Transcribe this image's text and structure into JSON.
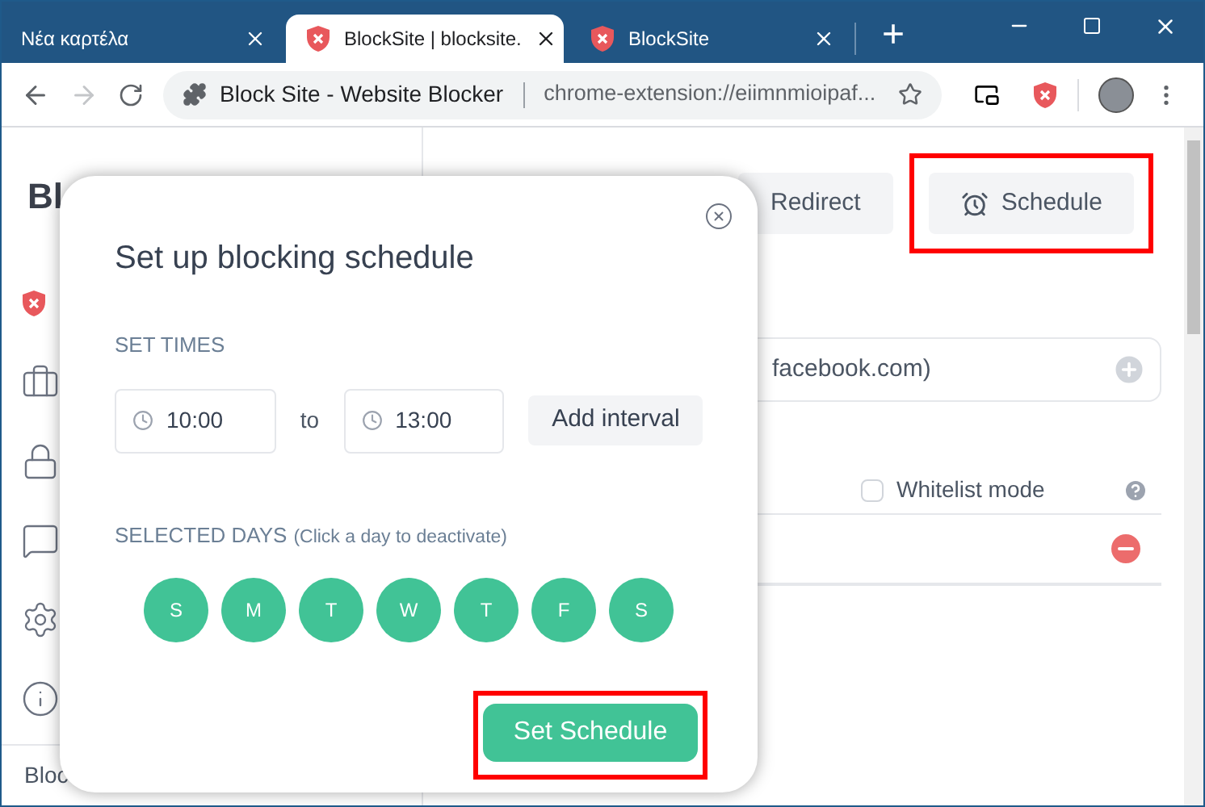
{
  "browser": {
    "tabs": [
      {
        "title": "Νέα καρτέλα",
        "selected": false,
        "favicon": false
      },
      {
        "title": "BlockSite | blocksite.",
        "selected": true,
        "favicon": true
      },
      {
        "title": "BlockSite",
        "selected": false,
        "favicon": true
      }
    ],
    "new_tab": "+",
    "address_bar": {
      "site_name": "Block Site - Website Blocker",
      "url": "chrome-extension://eiimnmioipaf..."
    }
  },
  "sidebar": {
    "title": "Bl",
    "footer": "Bloc",
    "items": [
      {
        "kind": "shield",
        "active": true
      },
      {
        "kind": "briefcase",
        "active": false
      },
      {
        "kind": "lock",
        "active": false
      },
      {
        "kind": "chat",
        "active": false
      },
      {
        "kind": "gear",
        "active": false
      },
      {
        "kind": "info",
        "active": false
      }
    ]
  },
  "main": {
    "tabs": [
      {
        "label": "Redirect",
        "highlighted": false
      },
      {
        "label": "Schedule",
        "highlighted": true
      }
    ],
    "site_input": {
      "placeholder": "facebook.com)"
    },
    "whitelist": {
      "label": "Whitelist mode",
      "checked": false
    }
  },
  "dialog": {
    "title": "Set up blocking schedule",
    "times_label": "SET TIMES",
    "from": "10:00",
    "separator": "to",
    "until": "13:00",
    "add_interval": "Add interval",
    "days_label": "SELECTED DAYS",
    "days_hint": "(Click a day to deactivate)",
    "days": [
      {
        "label": "S",
        "selected": true
      },
      {
        "label": "M",
        "selected": true
      },
      {
        "label": "T",
        "selected": true
      },
      {
        "label": "W",
        "selected": true
      },
      {
        "label": "T",
        "selected": true
      },
      {
        "label": "F",
        "selected": true
      },
      {
        "label": "S",
        "selected": true
      }
    ],
    "submit": {
      "label": "Set Schedule",
      "highlighted": true
    }
  }
}
